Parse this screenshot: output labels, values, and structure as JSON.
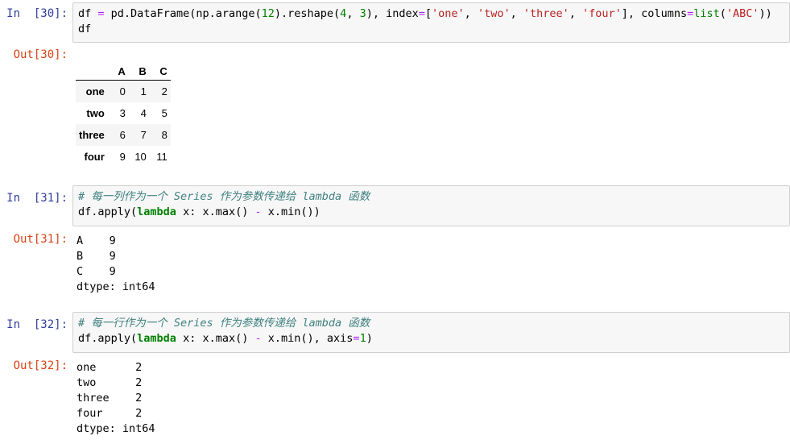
{
  "cells": [
    {
      "in_prompt": "In  [30]:",
      "code_line1": [
        {
          "t": "df",
          "c": "var"
        },
        {
          "t": " ",
          "c": "var"
        },
        {
          "t": "=",
          "c": "op"
        },
        {
          "t": " pd.DataFrame(np.arange(",
          "c": "var"
        },
        {
          "t": "12",
          "c": "num"
        },
        {
          "t": ").reshape(",
          "c": "var"
        },
        {
          "t": "4",
          "c": "num"
        },
        {
          "t": ", ",
          "c": "var"
        },
        {
          "t": "3",
          "c": "num"
        },
        {
          "t": "), index",
          "c": "var"
        },
        {
          "t": "=",
          "c": "op"
        },
        {
          "t": "[",
          "c": "var"
        },
        {
          "t": "'one'",
          "c": "str"
        },
        {
          "t": ", ",
          "c": "var"
        },
        {
          "t": "'two'",
          "c": "str"
        },
        {
          "t": ", ",
          "c": "var"
        },
        {
          "t": "'three'",
          "c": "str"
        },
        {
          "t": ", ",
          "c": "var"
        },
        {
          "t": "'four'",
          "c": "str"
        },
        {
          "t": "], columns",
          "c": "var"
        },
        {
          "t": "=",
          "c": "op"
        },
        {
          "t": "list",
          "c": "bi"
        },
        {
          "t": "(",
          "c": "var"
        },
        {
          "t": "'ABC'",
          "c": "str"
        },
        {
          "t": "))",
          "c": "var"
        }
      ],
      "code_line2": "df",
      "out_prompt": "Out[30]:",
      "table": {
        "columns": [
          "A",
          "B",
          "C"
        ],
        "rows": [
          {
            "index": "one",
            "values": [
              "0",
              "1",
              "2"
            ]
          },
          {
            "index": "two",
            "values": [
              "3",
              "4",
              "5"
            ]
          },
          {
            "index": "three",
            "values": [
              "6",
              "7",
              "8"
            ]
          },
          {
            "index": "four",
            "values": [
              "9",
              "10",
              "11"
            ]
          }
        ]
      }
    },
    {
      "in_prompt": "In  [31]:",
      "comment": "# 每一列作为一个 Series 作为参数传递给 lambda 函数",
      "code": [
        {
          "t": "df.apply(",
          "c": "var"
        },
        {
          "t": "lambda",
          "c": "kw"
        },
        {
          "t": " x: x.max() ",
          "c": "var"
        },
        {
          "t": "-",
          "c": "op"
        },
        {
          "t": " x.min())",
          "c": "var"
        }
      ],
      "out_prompt": "Out[31]:",
      "output": "A    9\nB    9\nC    9\ndtype: int64"
    },
    {
      "in_prompt": "In  [32]:",
      "comment": "# 每一行作为一个 Series 作为参数传递给 lambda 函数",
      "code": [
        {
          "t": "df.apply(",
          "c": "var"
        },
        {
          "t": "lambda",
          "c": "kw"
        },
        {
          "t": " x: x.max() ",
          "c": "var"
        },
        {
          "t": "-",
          "c": "op"
        },
        {
          "t": " x.min(), axis",
          "c": "var"
        },
        {
          "t": "=",
          "c": "op"
        },
        {
          "t": "1",
          "c": "num"
        },
        {
          "t": ")",
          "c": "var"
        }
      ],
      "out_prompt": "Out[32]:",
      "output": "one      2\ntwo      2\nthree    2\nfour     2\ndtype: int64"
    }
  ]
}
